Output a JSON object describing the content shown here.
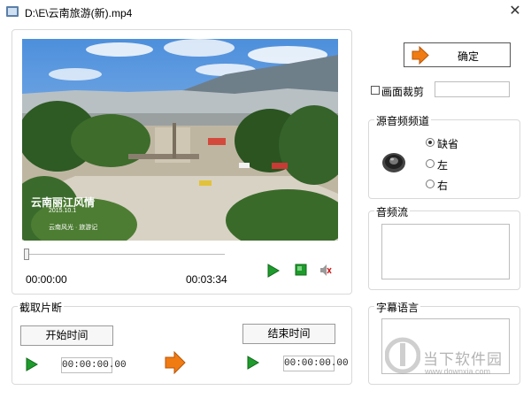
{
  "window": {
    "title": "D:\\E\\云南旅游(新).mp4",
    "close_glyph": "✕"
  },
  "video": {
    "overlay_title": "云南丽江风情",
    "overlay_date": "2015.10.1",
    "overlay_sub": "云南风光 · 旅游记"
  },
  "player": {
    "current_time": "00:00:00",
    "duration": "00:03:34",
    "progress_fraction": 0
  },
  "confirm": {
    "label": "确定"
  },
  "crop": {
    "checked": false,
    "label": "画面裁剪",
    "value": ""
  },
  "audio_channel": {
    "title": "源音频频道",
    "options": [
      {
        "label": "缺省",
        "checked": true
      },
      {
        "label": "左",
        "checked": false
      },
      {
        "label": "右",
        "checked": false
      }
    ]
  },
  "audio_stream": {
    "title": "音频流"
  },
  "subtitle": {
    "title": "字幕语言"
  },
  "clip": {
    "title": "截取片断",
    "start_label": "开始时间",
    "end_label": "结束时间",
    "start_time": "00:00:00.00",
    "end_time": "00:00:00.00"
  },
  "watermark": {
    "name": "当下软件园",
    "url": "www.downxia.com"
  },
  "colors": {
    "play_green": "#1e9b2c",
    "arrow_orange": "#f07b13",
    "border": "#d9d9d9"
  }
}
